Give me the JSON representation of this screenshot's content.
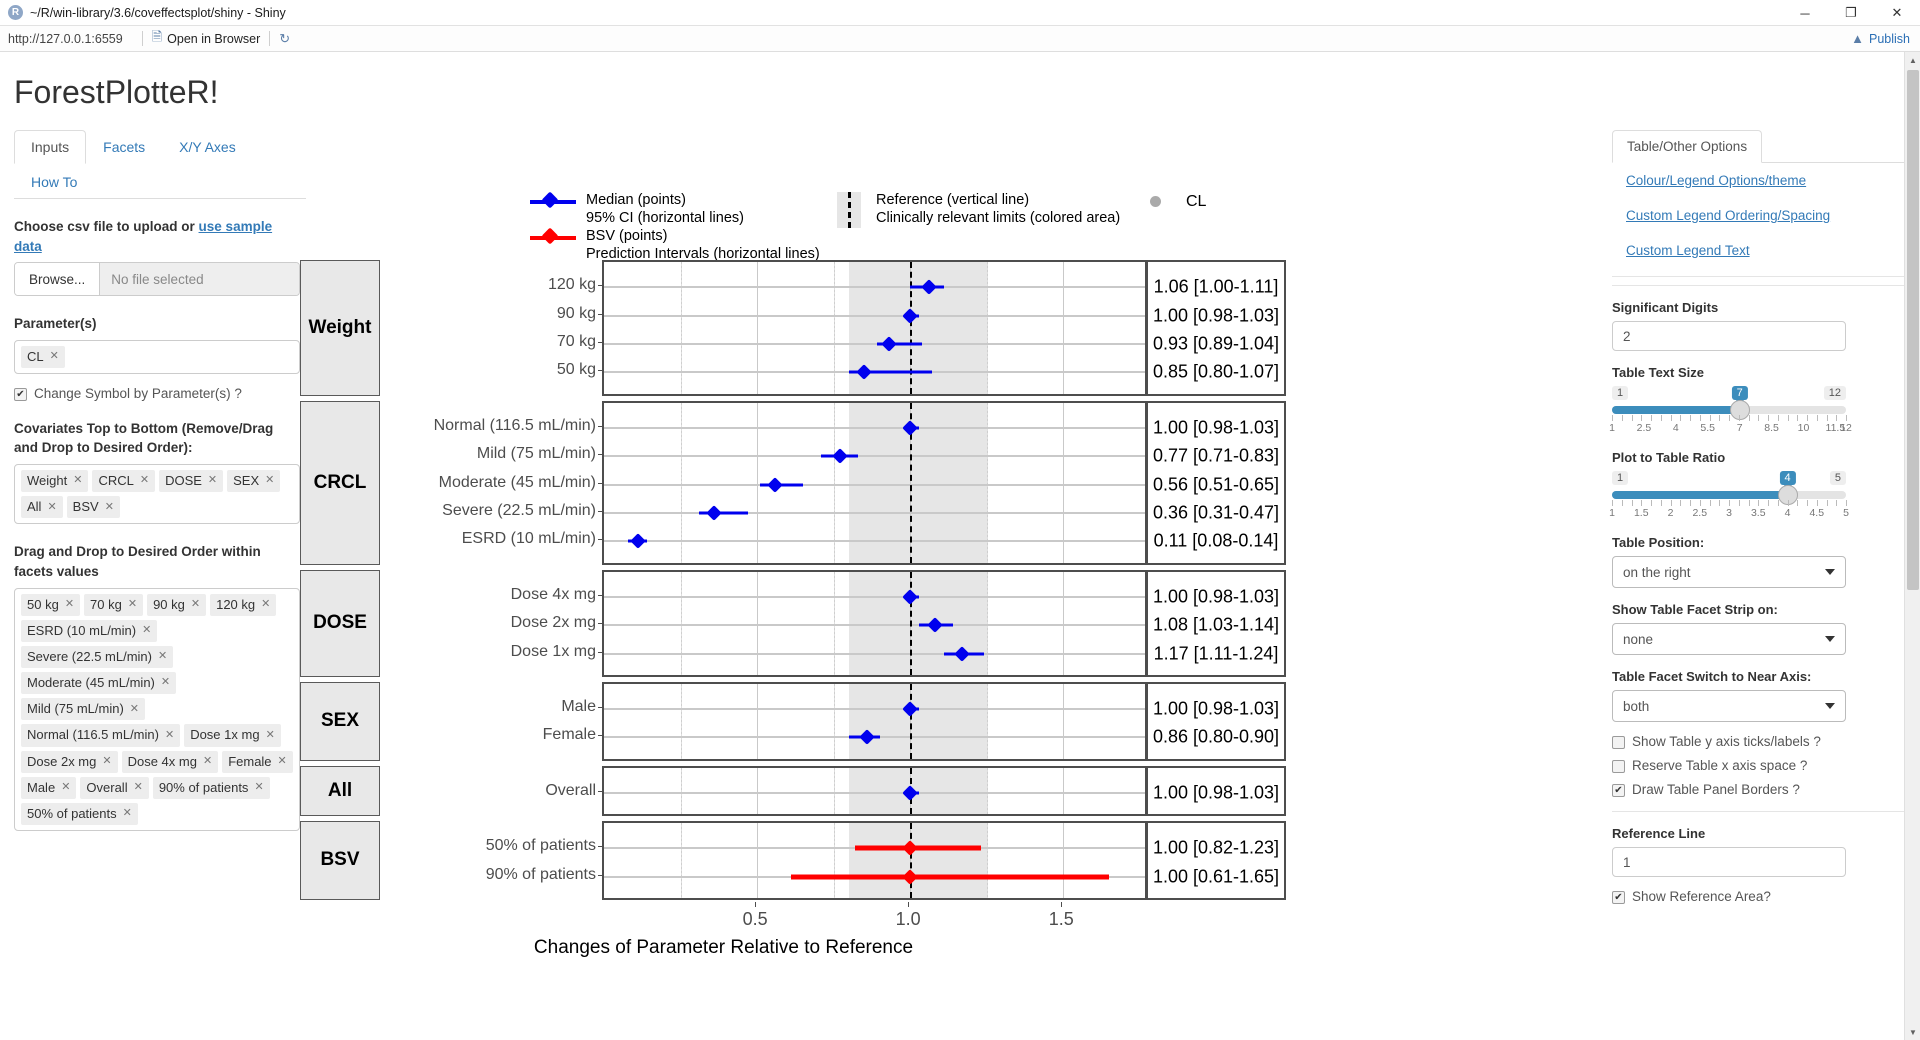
{
  "window": {
    "title": "~/R/win-library/3.6/coveffectsplot/shiny - Shiny",
    "logo_letter": "R",
    "minimize": "─",
    "maximize": "❐",
    "close": "✕"
  },
  "toolbar": {
    "url": "http://127.0.0.1:6559",
    "open_in_browser": "Open in Browser",
    "refresh_icon": "refresh-icon",
    "publish": "Publish"
  },
  "app": {
    "title": "ForestPlotteR!"
  },
  "left": {
    "tabs": [
      {
        "label": "Inputs",
        "active": true
      },
      {
        "label": "Facets",
        "active": false
      },
      {
        "label": "X/Y Axes",
        "active": false
      },
      {
        "label": "How To",
        "active": false
      }
    ],
    "upload_label_a": "Choose csv file to upload",
    "upload_label_or": " or ",
    "upload_link": "use sample data",
    "browse_button": "Browse...",
    "file_name": "No file selected",
    "parameters_label": "Parameter(s)",
    "parameters": [
      "CL"
    ],
    "change_symbol_label": "Change Symbol by Parameter(s) ?",
    "change_symbol_checked": true,
    "covariates_label": "Covariates Top to Bottom (Remove/Drag and Drop to Desired Order):",
    "covariates": [
      "Weight",
      "CRCL",
      "DOSE",
      "SEX",
      "All",
      "BSV"
    ],
    "facet_order_label": "Drag and Drop to Desired Order within facets values",
    "facet_values": [
      "50 kg",
      "70 kg",
      "90 kg",
      "120 kg",
      "ESRD (10 mL/min)",
      "Severe (22.5 mL/min)",
      "Moderate (45 mL/min)",
      "Mild (75 mL/min)",
      "Normal (116.5 mL/min)",
      "Dose 1x mg",
      "Dose 2x mg",
      "Dose 4x mg",
      "Female",
      "Male",
      "Overall",
      "90% of patients",
      "50% of patients"
    ]
  },
  "right": {
    "tabs": [
      {
        "label": "Table/Other Options",
        "active": true
      }
    ],
    "links": [
      "Colour/Legend Options/theme",
      "Custom Legend Ordering/Spacing",
      "Custom Legend Text"
    ],
    "significant_digits_label": "Significant Digits",
    "significant_digits_value": "2",
    "table_text_size_label": "Table Text Size",
    "table_text_size": {
      "min": "1",
      "max": "12",
      "value": "7",
      "ticks": [
        "1",
        "2.5",
        "4",
        "5.5",
        "7",
        "8.5",
        "10",
        "11.5",
        "12"
      ]
    },
    "plot_table_ratio_label": "Plot to Table Ratio",
    "plot_table_ratio": {
      "min": "1",
      "max": "5",
      "value": "4",
      "ticks": [
        "1",
        "1.5",
        "2",
        "2.5",
        "3",
        "3.5",
        "4",
        "4.5",
        "5"
      ]
    },
    "table_position_label": "Table Position:",
    "table_position_value": "on the right",
    "facet_strip_label": "Show Table Facet Strip on:",
    "facet_strip_value": "none",
    "facet_switch_label": "Table Facet Switch to Near Axis:",
    "facet_switch_value": "both",
    "checkboxes": [
      {
        "label": "Show Table y axis ticks/labels ?",
        "checked": false
      },
      {
        "label": "Reserve Table x axis space ?",
        "checked": false
      },
      {
        "label": "Draw Table Panel Borders ?",
        "checked": true
      }
    ],
    "reference_line_label": "Reference Line",
    "reference_line_value": "1",
    "show_reference_area_label": "Show Reference Area?",
    "show_reference_area_checked": true
  },
  "chart_data": {
    "type": "scatter",
    "title": "",
    "xlabel": "Changes of Parameter Relative to Reference",
    "ylabel": "",
    "xlim": [
      0.0,
      1.78
    ],
    "xticks": [
      0.5,
      1.0,
      1.5
    ],
    "xticklabels": [
      "0.5",
      "1.0",
      "1.5"
    ],
    "grid": true,
    "reference_line": 1.0,
    "reference_area": [
      0.8,
      1.25
    ],
    "legend": {
      "position": "top",
      "entries": [
        {
          "symbol": "blue-point-line",
          "color": "#0000EE",
          "lines": [
            "Median (points)",
            "95% CI (horizontal lines)"
          ]
        },
        {
          "symbol": "red-point-line",
          "color": "#FF0000",
          "lines": [
            "BSV (points)",
            "Prediction Intervals (horizontal lines)"
          ]
        },
        {
          "symbol": "dashed-band",
          "color": "#E6E6E6",
          "lines": [
            "Reference (vertical line)",
            "Clinically relevant limits (colored area)"
          ]
        },
        {
          "symbol": "grey-point",
          "color": "#AAAAAA",
          "lines": [
            "CL"
          ]
        }
      ]
    },
    "facets": [
      {
        "name": "Weight",
        "rows": [
          {
            "label": "120 kg",
            "median": 1.06,
            "lo": 1.0,
            "hi": 1.11,
            "color": "#0000EE",
            "table": "1.06 [1.00-1.11]"
          },
          {
            "label": "90 kg",
            "median": 1.0,
            "lo": 0.98,
            "hi": 1.03,
            "color": "#0000EE",
            "table": "1.00 [0.98-1.03]"
          },
          {
            "label": "70 kg",
            "median": 0.93,
            "lo": 0.89,
            "hi": 1.04,
            "color": "#0000EE",
            "table": "0.93 [0.89-1.04]"
          },
          {
            "label": "50 kg",
            "median": 0.85,
            "lo": 0.8,
            "hi": 1.07,
            "color": "#0000EE",
            "table": "0.85 [0.80-1.07]"
          }
        ]
      },
      {
        "name": "CRCL",
        "rows": [
          {
            "label": "Normal (116.5 mL/min)",
            "median": 1.0,
            "lo": 0.98,
            "hi": 1.03,
            "color": "#0000EE",
            "table": "1.00 [0.98-1.03]"
          },
          {
            "label": "Mild (75 mL/min)",
            "median": 0.77,
            "lo": 0.71,
            "hi": 0.83,
            "color": "#0000EE",
            "table": "0.77 [0.71-0.83]"
          },
          {
            "label": "Moderate (45 mL/min)",
            "median": 0.56,
            "lo": 0.51,
            "hi": 0.65,
            "color": "#0000EE",
            "table": "0.56 [0.51-0.65]"
          },
          {
            "label": "Severe (22.5 mL/min)",
            "median": 0.36,
            "lo": 0.31,
            "hi": 0.47,
            "color": "#0000EE",
            "table": "0.36 [0.31-0.47]"
          },
          {
            "label": "ESRD (10 mL/min)",
            "median": 0.11,
            "lo": 0.08,
            "hi": 0.14,
            "color": "#0000EE",
            "table": "0.11 [0.08-0.14]"
          }
        ]
      },
      {
        "name": "DOSE",
        "rows": [
          {
            "label": "Dose 4x mg",
            "median": 1.0,
            "lo": 0.98,
            "hi": 1.03,
            "color": "#0000EE",
            "table": "1.00 [0.98-1.03]"
          },
          {
            "label": "Dose 2x mg",
            "median": 1.08,
            "lo": 1.03,
            "hi": 1.14,
            "color": "#0000EE",
            "table": "1.08 [1.03-1.14]"
          },
          {
            "label": "Dose 1x mg",
            "median": 1.17,
            "lo": 1.11,
            "hi": 1.24,
            "color": "#0000EE",
            "table": "1.17 [1.11-1.24]"
          }
        ]
      },
      {
        "name": "SEX",
        "rows": [
          {
            "label": "Male",
            "median": 1.0,
            "lo": 0.98,
            "hi": 1.03,
            "color": "#0000EE",
            "table": "1.00 [0.98-1.03]"
          },
          {
            "label": "Female",
            "median": 0.86,
            "lo": 0.8,
            "hi": 0.9,
            "color": "#0000EE",
            "table": "0.86 [0.80-0.90]"
          }
        ]
      },
      {
        "name": "All",
        "rows": [
          {
            "label": "Overall",
            "median": 1.0,
            "lo": 0.98,
            "hi": 1.03,
            "color": "#0000EE",
            "table": "1.00 [0.98-1.03]"
          }
        ]
      },
      {
        "name": "BSV",
        "rows": [
          {
            "label": "50% of patients",
            "median": 1.0,
            "lo": 0.82,
            "hi": 1.23,
            "color": "#FF0000",
            "table": "1.00 [0.82-1.23]"
          },
          {
            "label": "90% of patients",
            "median": 1.0,
            "lo": 0.61,
            "hi": 1.65,
            "color": "#FF0000",
            "table": "1.00 [0.61-1.65]"
          }
        ]
      }
    ]
  }
}
